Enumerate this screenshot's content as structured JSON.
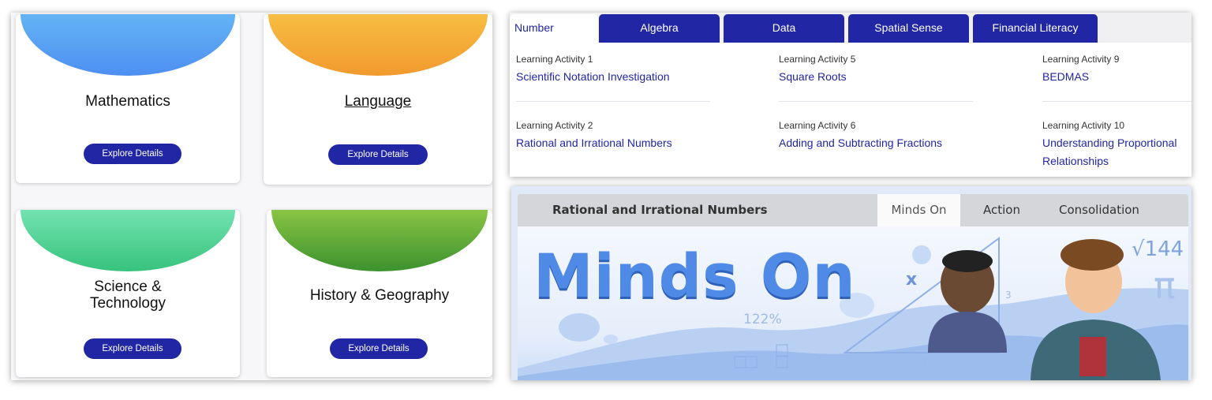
{
  "subjects": {
    "cards": [
      {
        "title": "Mathematics",
        "button": "Explore Details",
        "color_top": "#64b3f4",
        "color_bottom": "#4d8ff1"
      },
      {
        "title": "Language",
        "button": "Explore Details",
        "color_top": "#f7bd42",
        "color_bottom": "#f19a2e"
      },
      {
        "title": "Science & Technology",
        "button": "Explore Details",
        "color_top": "#72e2b0",
        "color_bottom": "#37c37d"
      },
      {
        "title": "History & Geography",
        "button": "Explore Details",
        "color_top": "#8ac444",
        "color_bottom": "#3c922e"
      }
    ]
  },
  "activities": {
    "tabs": [
      "Number",
      "Algebra",
      "Data",
      "Spatial Sense",
      "Financial Literacy"
    ],
    "active_tab": "Number",
    "items": [
      {
        "label": "Learning Activity 1",
        "title": "Scientific Notation Investigation"
      },
      {
        "label": "Learning Activity 2",
        "title": "Rational and Irrational Numbers"
      },
      {
        "label": "Learning Activity 5",
        "title": "Square Roots"
      },
      {
        "label": "Learning Activity 6",
        "title": "Adding and Subtracting Fractions"
      },
      {
        "label": "Learning Activity 9",
        "title": "BEDMAS"
      },
      {
        "label": "Learning Activity 10",
        "title": "Understanding Proportional Relationships"
      }
    ]
  },
  "lesson": {
    "title": "Rational and Irrational Numbers",
    "tabs": [
      "Minds On",
      "Action",
      "Consolidation"
    ],
    "active_tab": "Minds On",
    "banner": {
      "heading": "Minds On",
      "decor": [
        "x",
        "122%",
        "3",
        "4",
        "√144",
        "π"
      ]
    }
  },
  "colors": {
    "primary": "#2126a4",
    "link": "#2126a4"
  }
}
